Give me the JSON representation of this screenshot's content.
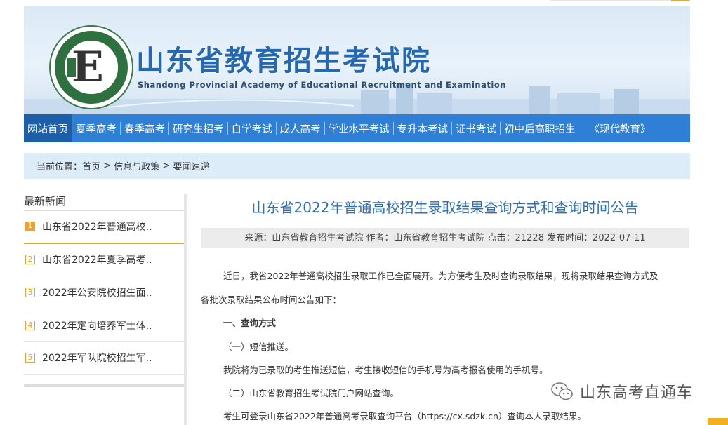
{
  "banner": {
    "title": "山东省教育招生考试院",
    "subtitle": "Shandong Provincial Academy of Educational Recruitment and Examination"
  },
  "nav": {
    "items": [
      {
        "label": "网站首页",
        "active": true
      },
      {
        "label": "夏季高考"
      },
      {
        "label": "春季高考"
      },
      {
        "label": "研究生招考"
      },
      {
        "label": "自学考试"
      },
      {
        "label": "成人高考"
      },
      {
        "label": "学业水平考试"
      },
      {
        "label": "专升本考试"
      },
      {
        "label": "证书考试"
      },
      {
        "label": "初中后高职招生"
      },
      {
        "label": "《现代教育》"
      }
    ]
  },
  "breadcrumb": {
    "prefix": "当前位置：",
    "home": "首页",
    "sep1": " > ",
    "section": "信息与政策",
    "sep2": " > ",
    "current": "要闻速递"
  },
  "sidebar": {
    "title": "最新新闻",
    "items": [
      {
        "num": "1",
        "text": "山东省2022年普通高校.."
      },
      {
        "num": "2",
        "text": "山东省2022年夏季高考.."
      },
      {
        "num": "3",
        "text": "2022年公安院校招生面.."
      },
      {
        "num": "4",
        "text": "2022年定向培养军士体.."
      },
      {
        "num": "5",
        "text": "2022年军队院校招生军.."
      }
    ]
  },
  "article": {
    "title": "山东省2022年普通高校招生录取结果查询方式和查询时间公告",
    "meta": "来源：山东省教育招生考试院 作者：山东省教育招生考试院 点击：21228 发布时间：2022-07-11",
    "paragraphs": [
      "近日，我省2022年普通高校招生录取工作已全面展开。为方便考生及时查询录取结果，现将录取结果查询方式及",
      "各批次录取结果公布时间公告如下：",
      "一、查询方式",
      "（一）短信推送。",
      "我院将为已录取的考生推送短信，考生接收短信的手机号为高考报名使用的手机号。",
      "（二）山东省教育招生考试院门户网站查询。",
      "考生可登录山东省2022年普通高考录取查询平台（https://cx.sdzk.cn）查询本人录取结果。"
    ]
  },
  "watermark": {
    "text": "山东高考直通车",
    "icon": "wechat-icon"
  },
  "colors": {
    "nav": "#2f7fd6",
    "nav_active": "#1d5ea8",
    "title_blue": "#2f6fb8",
    "accent_orange": "#f0a030",
    "crumb_bg": "#dcecf9"
  }
}
